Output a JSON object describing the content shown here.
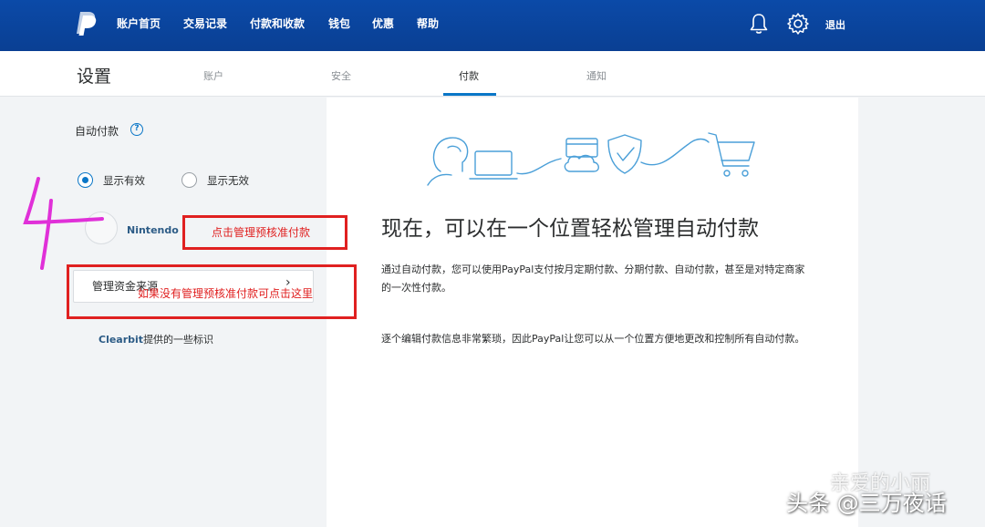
{
  "colors": {
    "nav_bg": "#0b4aa8",
    "accent": "#0a76c7",
    "annotation": "#e02020",
    "link": "#2c5b86"
  },
  "nav": {
    "logo": "paypal-logo",
    "items": [
      "账户首页",
      "交易记录",
      "付款和收款",
      "钱包",
      "优惠",
      "帮助"
    ],
    "logout": "退出"
  },
  "settings": {
    "title": "设置",
    "tabs": [
      "账户",
      "安全",
      "付款",
      "通知"
    ],
    "active_tab": "付款"
  },
  "left": {
    "autopay_label": "自动付款",
    "help_icon": "?",
    "filter_options": [
      "显示有效",
      "显示无效"
    ],
    "selected_filter": "显示有效",
    "merchant_name": "Nintendo",
    "manage_button": "管理资金来源",
    "clearbit_brand": "Clearbit",
    "clearbit_suffix": "提供的一些标识"
  },
  "main": {
    "headline": "现在，可以在一个位置轻松管理自动付款",
    "para1": "通过自动付款，您可以使用PayPal支付按月定期付款、分期付款、自动付款，甚至是对特定商家的一次性付款。",
    "para2": "逐个编辑付款信息非常繁琐，因此PayPal让您可以从一个位置方便地更改和控制所有自动付款。"
  },
  "annotations": {
    "step_number": "4",
    "note1": "点击管理预核准付款",
    "note2": "如果没有管理预核准付款可点击这里"
  },
  "watermark": {
    "top": "亲爱的小丽",
    "bottom": "头条 @三万夜话"
  }
}
